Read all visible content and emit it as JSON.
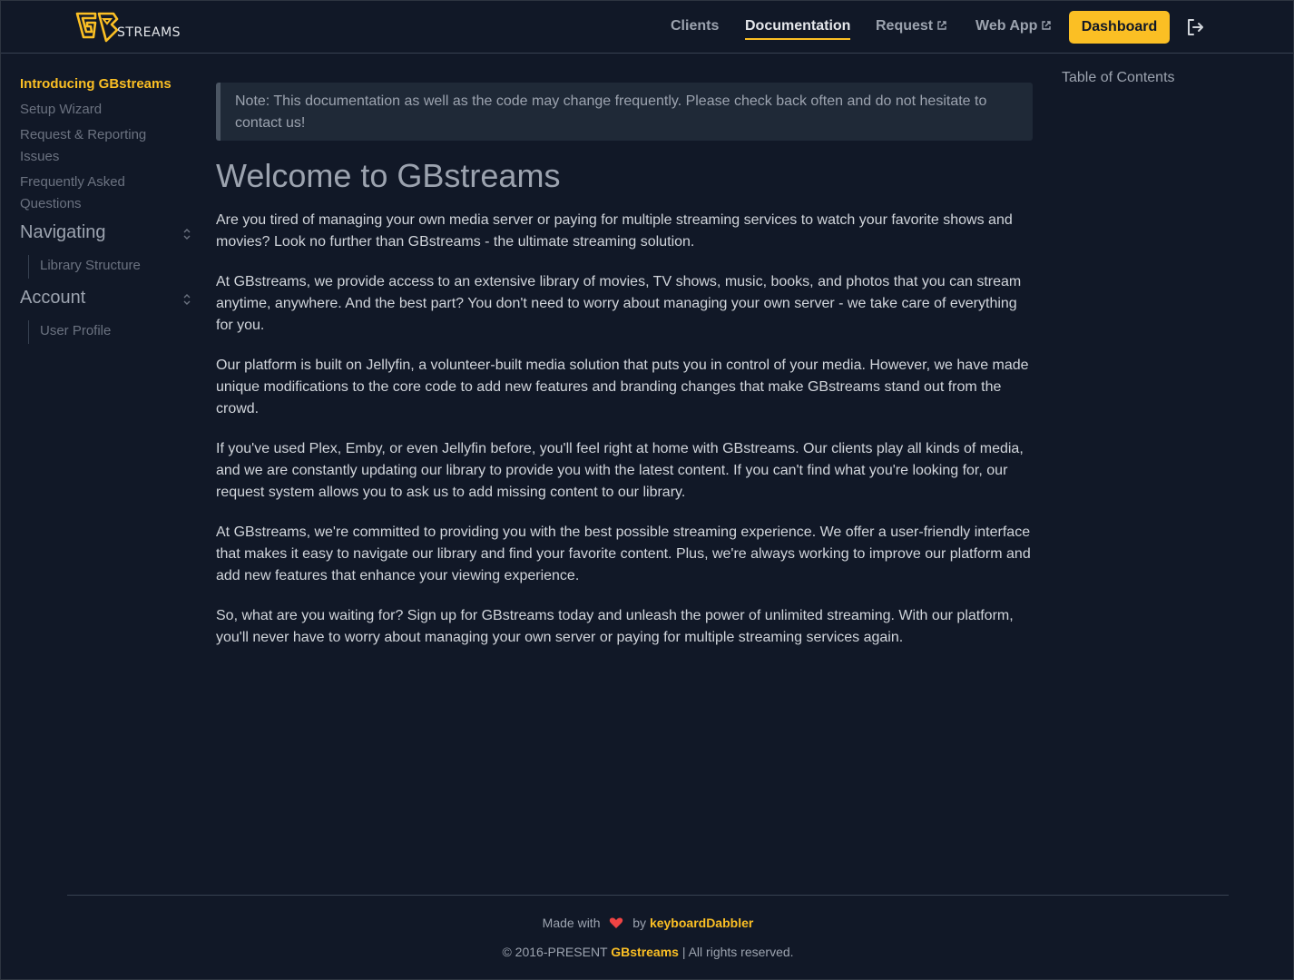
{
  "header": {
    "logo_text": "STREAMS",
    "nav": [
      {
        "label": "Clients"
      },
      {
        "label": "Documentation"
      },
      {
        "label": "Request"
      },
      {
        "label": "Web App"
      }
    ],
    "dashboard_label": "Dashboard"
  },
  "sidebar": {
    "items": [
      {
        "label": "Introducing GBstreams"
      },
      {
        "label": "Setup Wizard"
      },
      {
        "label": "Request & Reporting Issues"
      },
      {
        "label": "Frequently Asked Questions"
      }
    ],
    "sections": [
      {
        "label": "Navigating",
        "children": [
          {
            "label": "Library Structure"
          }
        ]
      },
      {
        "label": "Account",
        "children": [
          {
            "label": "User Profile"
          }
        ]
      }
    ]
  },
  "main": {
    "note": "Note: This documentation as well as the code may change frequently. Please check back often and do not hesitate to contact us!",
    "title": "Welcome to GBstreams",
    "paragraphs": [
      "Are you tired of managing your own media server or paying for multiple streaming services to watch your favorite shows and movies? Look no further than GBstreams - the ultimate streaming solution.",
      "At GBstreams, we provide access to an extensive library of movies, TV shows, music, books, and photos that you can stream anytime, anywhere. And the best part? You don't need to worry about managing your own server - we take care of everything for you.",
      "Our platform is built on Jellyfin, a volunteer-built media solution that puts you in control of your media. However, we have made unique modifications to the core code to add new features and branding changes that make GBstreams stand out from the crowd.",
      "If you've used Plex, Emby, or even Jellyfin before, you'll feel right at home with GBstreams. Our clients play all kinds of media, and we are constantly updating our library to provide you with the latest content. If you can't find what you're looking for, our request system allows you to ask us to add missing content to our library.",
      "At GBstreams, we're committed to providing you with the best possible streaming experience. We offer a user-friendly interface that makes it easy to navigate our library and find your favorite content. Plus, we're always working to improve our platform and add new features that enhance your viewing experience.",
      "So, what are you waiting for? Sign up for GBstreams today and unleash the power of unlimited streaming. With our platform, you'll never have to worry about managing your own server or paying for multiple streaming services again."
    ]
  },
  "toc": {
    "label": "Table of Contents"
  },
  "footer": {
    "made_with": "Made with",
    "by": "by",
    "author": "keyboardDabbler",
    "copyright": "© 2016-PRESENT",
    "brand": "GBstreams",
    "rights": "| All rights reserved."
  },
  "colors": {
    "accent": "#fbbf24",
    "background": "#111827",
    "note_bg": "#1f2937",
    "heart": "#ef4444"
  },
  "icons": [
    "gb-logo-icon",
    "external-link-icon",
    "logout-icon",
    "collapse-chevron-icon",
    "heart-icon"
  ]
}
